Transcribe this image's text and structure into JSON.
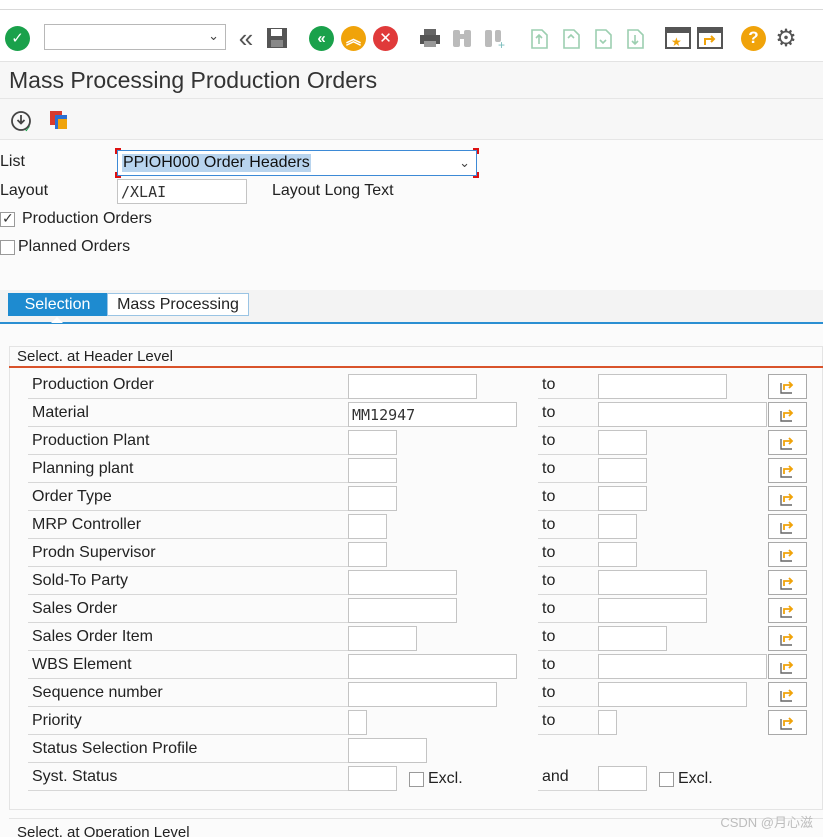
{
  "toolbar": {
    "command_field": "",
    "icons": [
      "enter-check-icon",
      "back-double-chevron-icon",
      "save-icon",
      "back-icon",
      "exit-icon",
      "cancel-icon",
      "print-icon",
      "find-icon",
      "find-next-icon",
      "first-page-icon",
      "previous-page-icon",
      "next-page-icon",
      "last-page-icon",
      "create-session-icon",
      "shortcut-icon",
      "help-icon",
      "settings-gear-icon"
    ],
    "colors": {
      "green": "#1aa14b",
      "yellow": "#f0a30a",
      "red": "#e03a3a"
    }
  },
  "title": "Mass Processing Production Orders",
  "app_toolbar": {
    "icons": [
      "execute-icon",
      "variants-icon"
    ]
  },
  "header": {
    "list_label": "List",
    "list_value": "PPIOH000 Order Headers",
    "layout_label": "Layout",
    "layout_value": "/XLAI",
    "layout_long_text_label": "Layout Long Text",
    "production_orders_label": "Production Orders",
    "production_orders_checked": true,
    "planned_orders_label": "Planned Orders",
    "planned_orders_checked": false
  },
  "tabs": [
    {
      "label": "Selection",
      "active": true
    },
    {
      "label": "Mass Processing",
      "active": false
    }
  ],
  "header_group": {
    "title": "Select. at Header Level",
    "to_label": "to",
    "and_label": "and",
    "excl_label": "Excl.",
    "rows": [
      {
        "label": "Production Order",
        "from": "",
        "to": ""
      },
      {
        "label": "Material",
        "from": "MM12947",
        "to": ""
      },
      {
        "label": "Production Plant",
        "from": "",
        "to": ""
      },
      {
        "label": "Planning plant",
        "from": "",
        "to": ""
      },
      {
        "label": "Order Type",
        "from": "",
        "to": ""
      },
      {
        "label": "MRP Controller",
        "from": "",
        "to": ""
      },
      {
        "label": "Prodn Supervisor",
        "from": "",
        "to": ""
      },
      {
        "label": "Sold-To Party",
        "from": "",
        "to": ""
      },
      {
        "label": "Sales Order",
        "from": "",
        "to": ""
      },
      {
        "label": "Sales Order Item",
        "from": "",
        "to": ""
      },
      {
        "label": "WBS Element",
        "from": "",
        "to": ""
      },
      {
        "label": "Sequence number",
        "from": "",
        "to": ""
      },
      {
        "label": "Priority",
        "from": "",
        "to": ""
      },
      {
        "label": "Status Selection Profile",
        "from": ""
      },
      {
        "label": "Syst. Status",
        "from": "",
        "to": ""
      }
    ]
  },
  "operation_group": {
    "title": "Select. at Operation Level"
  },
  "watermark": "CSDN @月心滋"
}
